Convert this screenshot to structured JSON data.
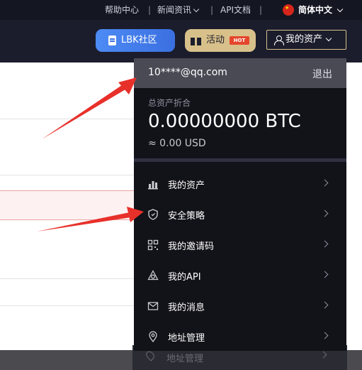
{
  "topbar": {
    "help": "帮助中心",
    "news": "新闻资讯",
    "api_docs": "API文档",
    "language": "简体中文",
    "separator": "|"
  },
  "navbar": {
    "community_label": "LBK社区",
    "activity_label": "活动",
    "hot_badge": "HOT",
    "assets_label": "我的资产"
  },
  "account_menu": {
    "email": "10****@qq.com",
    "logout": "退出",
    "total_label": "总资产折合",
    "btc_value": "0.00000000 BTC",
    "usd_value": "≈ 0.00 USD",
    "items": [
      {
        "label": "我的资产",
        "icon": "assets-bars-icon"
      },
      {
        "label": "安全策略",
        "icon": "shield-icon"
      },
      {
        "label": "我的邀请码",
        "icon": "qr-code-icon"
      },
      {
        "label": "我的API",
        "icon": "api-network-icon"
      },
      {
        "label": "我的消息",
        "icon": "mail-icon"
      },
      {
        "label": "地址管理",
        "icon": "location-pin-icon"
      }
    ],
    "ghost_item": "地址管理"
  },
  "colors": {
    "topbar_bg": "#141622",
    "navbar_bg": "#1b1d2c",
    "gold_accent": "#d8c08a",
    "blue_accent": "#3a6fe0",
    "arrow_red": "#e8302a",
    "dropdown_bg": "#121219"
  }
}
